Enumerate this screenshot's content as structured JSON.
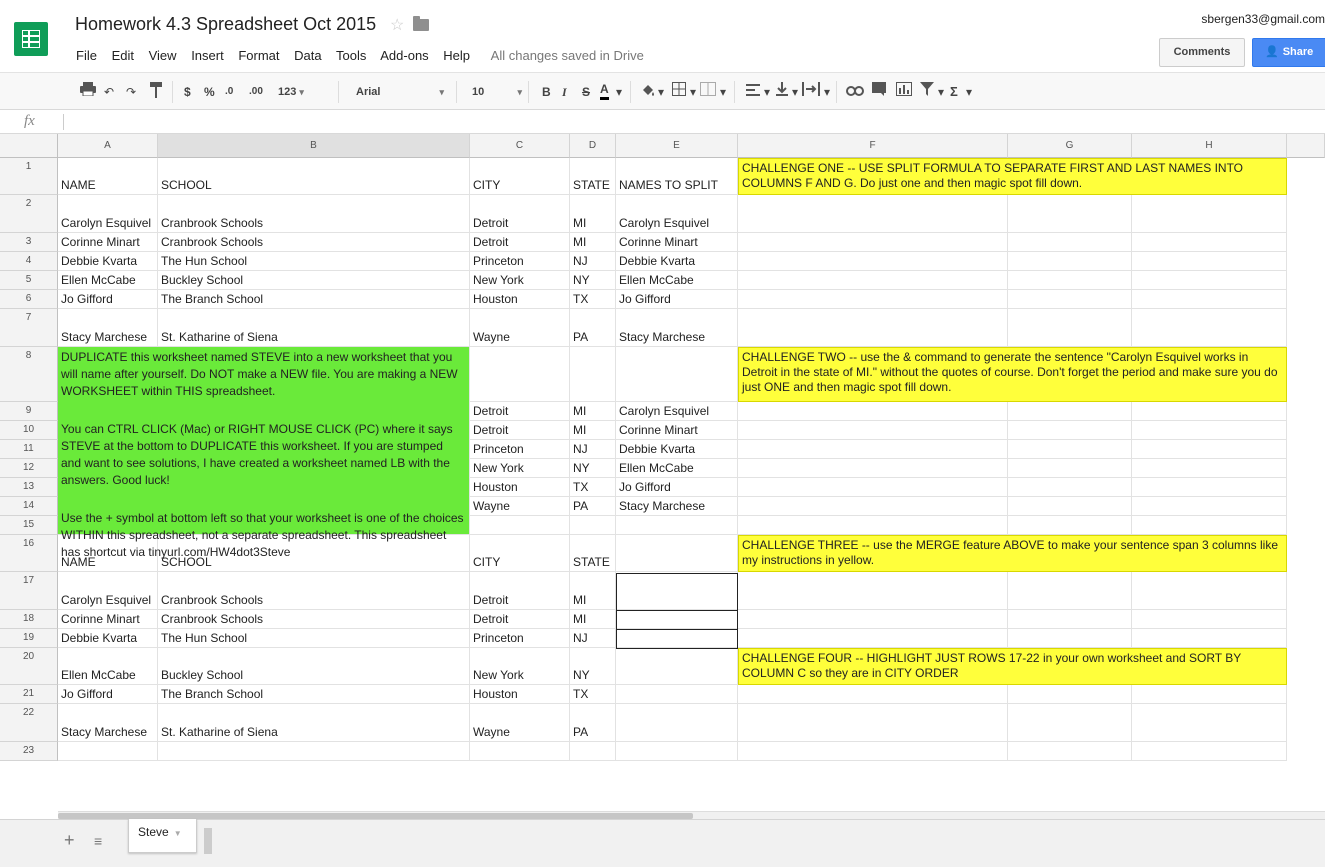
{
  "app": {
    "doc_title": "Homework 4.3 Spreadsheet Oct 2015",
    "user_email": "sbergen33@gmail.com",
    "save_status": "All changes saved in Drive",
    "comments_label": "Comments",
    "share_label": "Share",
    "menu": [
      "File",
      "Edit",
      "View",
      "Insert",
      "Format",
      "Data",
      "Tools",
      "Add-ons",
      "Help"
    ]
  },
  "toolbar": {
    "currency": "$",
    "percent": "%",
    "dec_less": ".0",
    "dec_more": ".00",
    "number_format": "123",
    "font": "Arial",
    "font_size": "10",
    "bold": "B",
    "italic": "I",
    "strike": "S",
    "text_color": "A",
    "sum": "Σ"
  },
  "formula_bar": {
    "fx": "fx"
  },
  "grid": {
    "columns": [
      "A",
      "B",
      "C",
      "D",
      "E",
      "F",
      "G",
      "H"
    ],
    "rows": [
      "1",
      "2",
      "3",
      "4",
      "5",
      "6",
      "7",
      "8",
      "9",
      "10",
      "11",
      "12",
      "13",
      "14",
      "15",
      "16",
      "17",
      "18",
      "19",
      "20",
      "21",
      "22",
      "23"
    ],
    "cells": {
      "A1": "NAME",
      "B1": "SCHOOL",
      "C1": "CITY",
      "D1": "STATE",
      "E1": "NAMES TO SPLIT",
      "F1": "CHALLENGE ONE -- USE SPLIT FORMULA TO SEPARATE FIRST AND LAST NAMES INTO COLUMNS F AND G. Do just one and then magic spot fill down.",
      "A2": "Carolyn Esquivel",
      "B2": "Cranbrook Schools",
      "C2": "Detroit",
      "D2": "MI",
      "E2": "Carolyn Esquivel",
      "A3": "Corinne Minart",
      "B3": "Cranbrook Schools",
      "C3": "Detroit",
      "D3": "MI",
      "E3": "Corinne Minart",
      "A4": "Debbie Kvarta",
      "B4": "The Hun School",
      "C4": "Princeton",
      "D4": "NJ",
      "E4": "Debbie Kvarta",
      "A5": "Ellen McCabe",
      "B5": "Buckley School",
      "C5": "New York",
      "D5": "NY",
      "E5": "Ellen McCabe",
      "A6": "Jo Gifford",
      "B6": "The Branch School",
      "C6": "Houston",
      "D6": "TX",
      "E6": "Jo Gifford",
      "A7": "Stacy Marchese",
      "B7": "St. Katharine of Siena",
      "C7": "Wayne",
      "D7": "PA",
      "E7": "Stacy Marchese",
      "A8_p1": "DUPLICATE this worksheet named STEVE into a new worksheet that you will name after yourself. Do NOT make a NEW file. You are making a NEW WORKSHEET within THIS spreadsheet.",
      "A8_p2": "You can CTRL CLICK (Mac) or RIGHT MOUSE CLICK (PC) where it says STEVE at the bottom to DUPLICATE this worksheet. If you are stumped and want to see solutions, I have created a worksheet named LB with the answers. Good luck!",
      "A8_p3": "Use the + symbol at bottom left so that your worksheet is one of the choices WITHIN this spreadsheet, not a separate spreadsheet. This spreadsheet has shortcut via tinyurl.com/HW4dot3Steve",
      "F8": "CHALLENGE TWO -- use the & command to generate the sentence \"Carolyn Esquivel works in Detroit in the state of MI.\" without the quotes of course. Don't forget the period and make sure you do just ONE and then magic spot fill down.",
      "C9": "Detroit",
      "D9": "MI",
      "E9": "Carolyn Esquivel",
      "C10": "Detroit",
      "D10": "MI",
      "E10": "Corinne Minart",
      "C11": "Princeton",
      "D11": "NJ",
      "E11": "Debbie Kvarta",
      "C12": "New York",
      "D12": "NY",
      "E12": "Ellen McCabe",
      "C13": "Houston",
      "D13": "TX",
      "E13": "Jo Gifford",
      "C14": "Wayne",
      "D14": "PA",
      "E14": "Stacy Marchese",
      "A16": "NAME",
      "B16": "SCHOOL",
      "C16": "CITY",
      "D16": "STATE",
      "F16": "CHALLENGE THREE -- use the MERGE feature ABOVE to make your sentence span 3 columns like my instructions in yellow.",
      "A17": "Carolyn Esquivel",
      "B17": "Cranbrook Schools",
      "C17": "Detroit",
      "D17": "MI",
      "A18": "Corinne Minart",
      "B18": "Cranbrook Schools",
      "C18": "Detroit",
      "D18": "MI",
      "A19": "Debbie Kvarta",
      "B19": "The Hun School",
      "C19": "Princeton",
      "D19": "NJ",
      "F20": "CHALLENGE FOUR -- HIGHLIGHT JUST ROWS 17-22 in your own worksheet and SORT BY COLUMN C so they are in CITY ORDER",
      "A20": "Ellen McCabe",
      "B20": "Buckley School",
      "C20": "New York",
      "D20": "NY",
      "A21": "Jo Gifford",
      "B21": "The Branch School",
      "C21": "Houston",
      "D21": "TX",
      "A22": "Stacy Marchese",
      "B22": "St. Katharine of Siena",
      "C22": "Wayne",
      "D22": "PA"
    }
  },
  "sheets": {
    "active": "Steve"
  },
  "colors": {
    "green": "#6aea3a",
    "yellow": "#ffff3b",
    "share_blue": "#4a8af4",
    "logo_green": "#0f9d58"
  }
}
